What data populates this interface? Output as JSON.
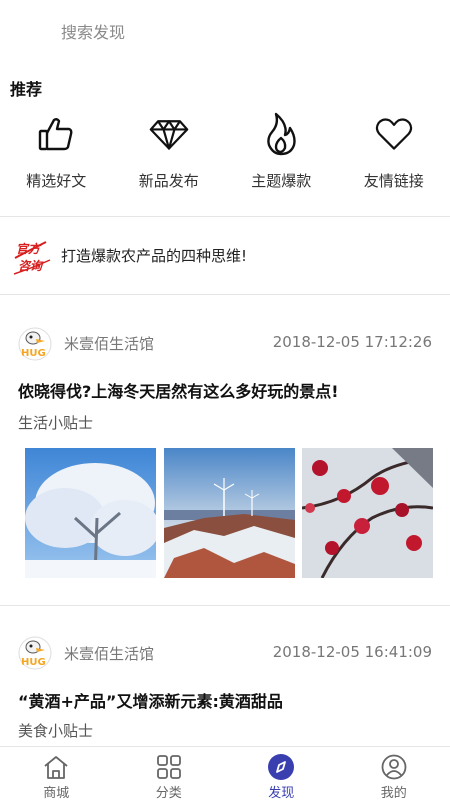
{
  "search": {
    "placeholder": "搜索发现"
  },
  "recommend": {
    "title": "推荐",
    "items": [
      {
        "label": "精选好文",
        "icon": "thumbs-up-icon"
      },
      {
        "label": "新品发布",
        "icon": "diamond-icon"
      },
      {
        "label": "主题爆款",
        "icon": "flame-icon"
      },
      {
        "label": "友情链接",
        "icon": "heart-icon"
      }
    ]
  },
  "news": {
    "badge_line1": "官方",
    "badge_line2": "咨询",
    "text": "打造爆款农产品的四种思维!"
  },
  "posts": [
    {
      "avatar_text": "HUG",
      "author": "米壹佰生活馆",
      "time": "2018-12-05 17:12:26",
      "title": "侬晓得伐?上海冬天居然有这么多好玩的景点!",
      "category": "生活小贴士",
      "images": [
        "snow-tree-image",
        "snowy-mountain-windmill-image",
        "plum-blossom-image"
      ]
    },
    {
      "avatar_text": "HUG",
      "author": "米壹佰生活馆",
      "time": "2018-12-05 16:41:09",
      "title": "“黄酒+产品”又增添新元素:黄酒甜品",
      "category": "美食小贴士"
    }
  ],
  "tabbar": {
    "active": "发现",
    "items": [
      {
        "label": "商城",
        "icon": "home-icon"
      },
      {
        "label": "分类",
        "icon": "grid-icon"
      },
      {
        "label": "发现",
        "icon": "compass-icon"
      },
      {
        "label": "我的",
        "icon": "user-icon"
      }
    ]
  },
  "colors": {
    "accent": "#3a3fb0",
    "badge_red": "#d81e1e",
    "divider": "#e6e6e6"
  }
}
